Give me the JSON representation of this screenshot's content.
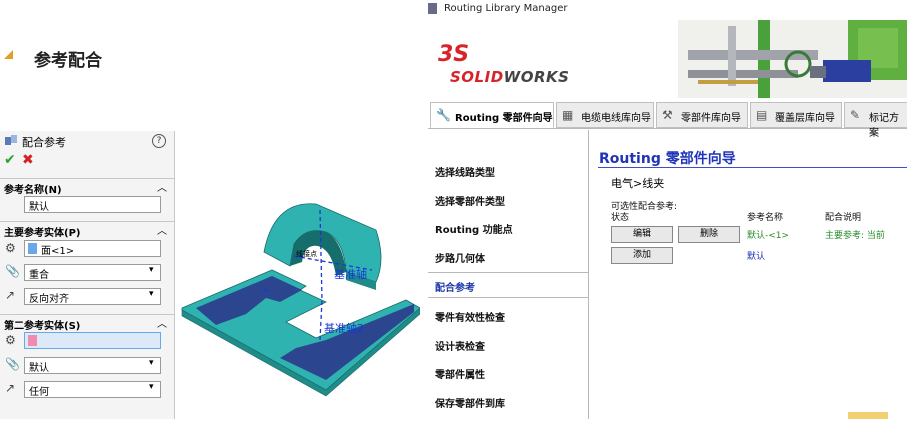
{
  "slide": {
    "title": "参考配合"
  },
  "pm": {
    "title": "配合参考",
    "help": "?",
    "ok": "✔",
    "cancel": "✖",
    "sections": {
      "name": {
        "label": "参考名称(N)",
        "value": "默认"
      },
      "primary": {
        "label": "主要参考实体(P)",
        "entity": "面<1>",
        "mate_type": "重合",
        "alignment": "反向对齐"
      },
      "secondary": {
        "label": "第二参考实体(S)",
        "entity": "",
        "mate_type": "默认",
        "alignment": "任何"
      }
    }
  },
  "model": {
    "axis1": "基准轴",
    "axis2": "基准轴2",
    "point": "线接点"
  },
  "window": {
    "title": "Routing Library Manager",
    "logo_mark": "3S",
    "logo_text_1": "SOLID",
    "logo_text_2": "WORKS",
    "tabs": [
      {
        "label": "Routing 零部件向导"
      },
      {
        "label": "电缆电线库向导"
      },
      {
        "label": "零部件库向导"
      },
      {
        "label": "覆盖层库向导"
      },
      {
        "label": "标记方案"
      }
    ],
    "nav": [
      {
        "label": "选择线路类型"
      },
      {
        "label": "选择零部件类型"
      },
      {
        "label": "Routing 功能点"
      },
      {
        "label": "步路几何体"
      },
      {
        "label": "配合参考"
      },
      {
        "label": "零件有效性检查"
      },
      {
        "label": "设计表检查"
      },
      {
        "label": "零部件属性"
      },
      {
        "label": "保存零部件到库"
      }
    ],
    "main": {
      "title": "Routing 零部件向导",
      "breadcrumb": "电气>线夹",
      "optional_label": "可选性配合参考:",
      "col_status": "状态",
      "col_name": "参考名称",
      "col_desc": "配合说明",
      "edit_btn": "编辑",
      "delete_btn": "删除",
      "add_btn": "添加",
      "row1_name": "默认-<1>",
      "row1_desc": "主要参考: 当前",
      "row2_name": "默认"
    }
  },
  "colors": {
    "accent_blue": "#1f34b8",
    "model_teal": "#2fb3b0",
    "solidworks_red": "#d8232a"
  }
}
